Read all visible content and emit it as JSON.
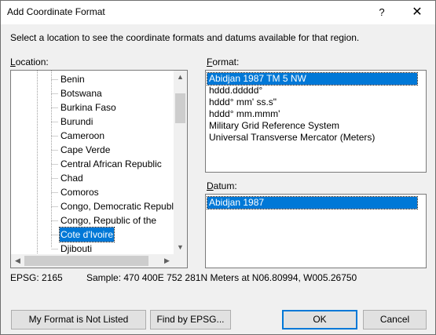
{
  "window": {
    "title": "Add Coordinate Format",
    "help_glyph": "?",
    "close_glyph": "✕"
  },
  "instruction": "Select a location to see the coordinate formats and datums available for that region.",
  "location": {
    "label_first": "L",
    "label_rest": "ocation:",
    "items": [
      "Benin",
      "Botswana",
      "Burkina Faso",
      "Burundi",
      "Cameroon",
      "Cape Verde",
      "Central African Republic",
      "Chad",
      "Comoros",
      "Congo, Democratic Republi",
      "Congo, Republic of the",
      "Cote d'Ivoire",
      "Djibouti"
    ],
    "selected": "Cote d'Ivoire",
    "scroll_up": "▲",
    "scroll_down": "▼",
    "scroll_left": "◀",
    "scroll_right": "▶"
  },
  "format": {
    "label_first": "F",
    "label_rest": "ormat:",
    "items": [
      "Abidjan 1987 TM 5 NW",
      "hddd.ddddd°",
      "hddd° mm' ss.s\"",
      "hddd° mm.mmm'",
      "Military Grid Reference System",
      "Universal Transverse Mercator (Meters)"
    ],
    "selected": "Abidjan 1987 TM 5 NW"
  },
  "datum": {
    "label_first": "D",
    "label_rest": "atum:",
    "items": [
      "Abidjan 1987"
    ],
    "selected": "Abidjan 1987"
  },
  "status": {
    "epsg": "EPSG: 2165",
    "sample": "Sample: 470 400E  752 281N Meters at N06.80994, W005.26750"
  },
  "buttons": {
    "not_listed": "My Format is Not Listed",
    "find_epsg": "Find by EPSG...",
    "ok": "OK",
    "cancel": "Cancel"
  },
  "colors": {
    "selection": "#0078d7",
    "dialog_bg": "#f0f0f0"
  }
}
